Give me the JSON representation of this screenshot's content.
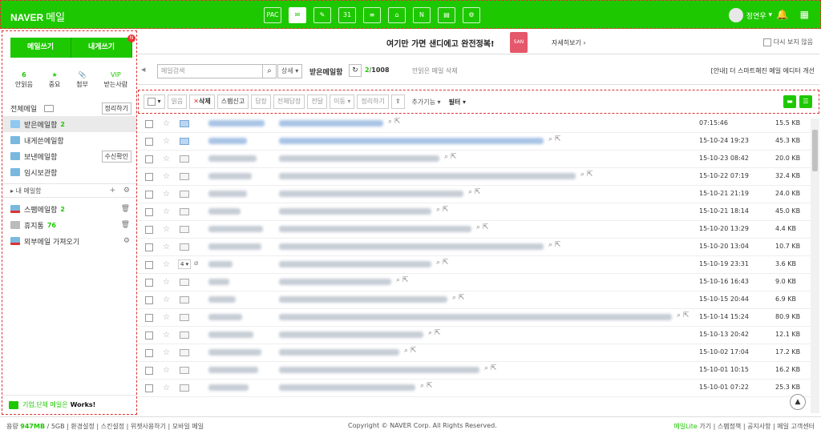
{
  "header": {
    "logo": "NAVER",
    "logo_sub": "메일",
    "apps": [
      "PAC",
      "✉",
      "✎",
      "31",
      "≡",
      "⌂",
      "N",
      "▤",
      "⚙"
    ],
    "user_name": "정연우"
  },
  "sidebar": {
    "write_label": "메일쓰기",
    "self_write_label": "내게쓰기",
    "badge": "N",
    "quick": [
      {
        "num": "6",
        "label": "안읽음"
      },
      {
        "num": "★",
        "label": "중요"
      },
      {
        "num": "📎",
        "label": "첨부"
      },
      {
        "num": "VIP",
        "label": "받는사람"
      }
    ],
    "folders": [
      {
        "label": "전체메일",
        "btn": "정리하기"
      },
      {
        "label": "받은메일함",
        "count": "2"
      },
      {
        "label": "내게쓴메일함"
      },
      {
        "label": "보낸메일함",
        "btn": "수신확인"
      },
      {
        "label": "임시보관함"
      }
    ],
    "mybox": "내 메일함",
    "extra": [
      {
        "label": "스팸메일함",
        "count": "2"
      },
      {
        "label": "휴지통",
        "count": "76"
      },
      {
        "label": "외부메일 가져오기"
      }
    ],
    "works_text": "기업,단체 메일은",
    "works_bold": "Works!"
  },
  "banner": {
    "text": "여기만 가면 샌디에고 완전정복!",
    "gift": "SAN",
    "more": "자세히보기 ›",
    "hide": "다시 보지 않음"
  },
  "search": {
    "placeholder": "메일검색",
    "detail": "상세 ▾",
    "box": "받은메일함",
    "unread": "2",
    "total": "1008",
    "delete_all": "안읽은 메일 삭제",
    "notice": "[안내] 더 스마트해진 메일 에디터 개선"
  },
  "toolbar": {
    "read": "읽음",
    "delete": "삭제",
    "spam": "스팸신고",
    "reply": "답장",
    "reply_all": "전체답장",
    "forward": "전달",
    "move": "이동 ▾",
    "organize": "정리하기",
    "more": "추가기능 ▾",
    "filter": "필터 ▾"
  },
  "rows": [
    {
      "date": "07:15:46",
      "size": "15.5 KB",
      "unread": true
    },
    {
      "date": "15-10-24 19:23",
      "size": "45.3 KB",
      "unread": true
    },
    {
      "date": "15-10-23 08:42",
      "size": "20.0 KB"
    },
    {
      "date": "15-10-22 07:19",
      "size": "32.4 KB"
    },
    {
      "date": "15-10-21 21:19",
      "size": "24.0 KB"
    },
    {
      "date": "15-10-21 18:14",
      "size": "45.0 KB"
    },
    {
      "date": "15-10-20 13:29",
      "size": "4.4 KB"
    },
    {
      "date": "15-10-20 13:04",
      "size": "10.7 KB"
    },
    {
      "date": "15-10-19 23:31",
      "size": "3.6 KB",
      "thread": "4 ▾"
    },
    {
      "date": "15-10-16 16:43",
      "size": "9.0 KB"
    },
    {
      "date": "15-10-15 20:44",
      "size": "6.9 KB"
    },
    {
      "date": "15-10-14 15:24",
      "size": "80.9 KB"
    },
    {
      "date": "15-10-13 20:42",
      "size": "12.1 KB"
    },
    {
      "date": "15-10-02 17:04",
      "size": "17.2 KB"
    },
    {
      "date": "15-10-01 10:15",
      "size": "16.2 KB"
    },
    {
      "date": "15-10-01 07:22",
      "size": "25.3 KB"
    }
  ],
  "footer": {
    "usage": "용량",
    "usage_val": "947MB",
    "quota": "/ 5GB",
    "links_left": "환경설정 | 스킨설정 | 위젯사용하기 | 모바일 메일",
    "copyright": "Copyright © NAVER Corp. All Rights Reserved.",
    "lite": "메일Lite",
    "links_right": "가기 | 스팸정책 | 공지사항 | 메일 고객센터"
  }
}
